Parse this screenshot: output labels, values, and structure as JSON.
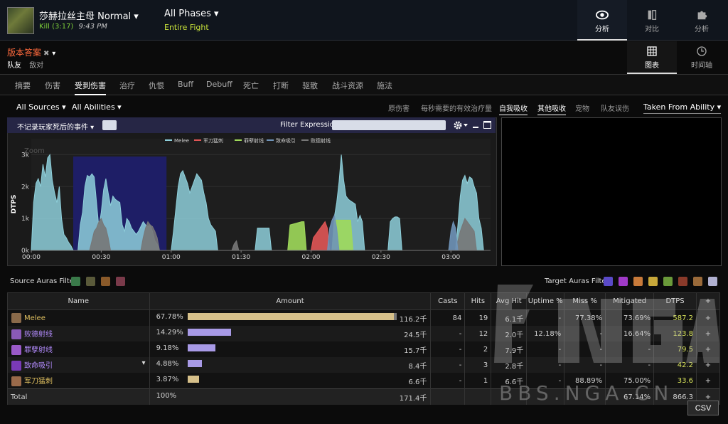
{
  "header": {
    "boss_name": "莎赫拉丝主母 Normal ▾",
    "kill": "Kill (3:17)",
    "time": "9:43 PM",
    "phases": "All Phases ▾",
    "fight": "Entire Fight",
    "nav": [
      {
        "label": "分析",
        "icon": "eye-icon"
      },
      {
        "label": "对比",
        "icon": "compare-icon"
      },
      {
        "label": "分析",
        "icon": "puzzle-icon"
      }
    ]
  },
  "report": {
    "title": "版本答案",
    "close": "✖",
    "caret": "▾",
    "team_tabs": [
      "队友",
      "敌对"
    ]
  },
  "view_nav": [
    {
      "label": "图表",
      "icon": "grid-icon"
    },
    {
      "label": "时间轴",
      "icon": "clock-icon"
    }
  ],
  "tabs": [
    "摘要",
    "伤害",
    "受到伤害",
    "治疗",
    "仇恨",
    "Buff",
    "Debuff",
    "死亡",
    "打断",
    "驱散",
    "战斗资源",
    "施法"
  ],
  "filters": {
    "sources": "All Sources ▾",
    "abilities": "All Abilities ▾",
    "options": [
      "原伤害",
      "每秒需要的有效治疗量",
      "自我吸收",
      "其他吸收",
      "宠物",
      "队友误伤"
    ],
    "taken_from": "Taken From Ability ▾"
  },
  "graph": {
    "no_death": "不记录玩家死后的事件 ▾",
    "filter_label": "Filter Expression:",
    "filter_value": "",
    "settings_icon": "gear-icon"
  },
  "chart_data": {
    "type": "area",
    "title": "",
    "xlabel": "",
    "ylabel": "DTPS",
    "zoom_label": "Zoom",
    "xticks": [
      "00:00",
      "00:30",
      "01:00",
      "01:30",
      "02:00",
      "02:30",
      "03:00"
    ],
    "yticks": [
      "0k",
      "1k",
      "2k",
      "3k"
    ],
    "ylim": [
      0,
      3500
    ],
    "xlim": [
      0,
      197
    ],
    "grid": true,
    "legend_position": "top",
    "selection_range": [
      18,
      58
    ],
    "series": [
      {
        "name": "Melee",
        "color": "#8ecfda",
        "points": [
          [
            0,
            0
          ],
          [
            1,
            1500
          ],
          [
            2,
            2100
          ],
          [
            3,
            2250
          ],
          [
            4,
            2000
          ],
          [
            5,
            2700
          ],
          [
            6,
            2300
          ],
          [
            7,
            2900
          ],
          [
            8,
            3000
          ],
          [
            9,
            2200
          ],
          [
            10,
            1800
          ],
          [
            11,
            1500
          ],
          [
            12,
            2000
          ],
          [
            13,
            1000
          ],
          [
            14,
            500
          ],
          [
            15,
            400
          ],
          [
            16,
            250
          ],
          [
            17,
            150
          ],
          [
            18,
            0
          ],
          [
            20,
            0
          ],
          [
            21,
            800
          ],
          [
            22,
            1200
          ],
          [
            23,
            2000
          ],
          [
            24,
            2350
          ],
          [
            25,
            2300
          ],
          [
            26,
            2400
          ],
          [
            27,
            2300
          ],
          [
            28,
            1500
          ],
          [
            29,
            700
          ],
          [
            30,
            1200
          ],
          [
            31,
            1900
          ],
          [
            32,
            2250
          ],
          [
            33,
            1800
          ],
          [
            34,
            1400
          ],
          [
            35,
            1700
          ],
          [
            36,
            1600
          ],
          [
            37,
            1550
          ],
          [
            38,
            1500
          ],
          [
            39,
            800
          ],
          [
            40,
            600
          ],
          [
            41,
            1000
          ],
          [
            42,
            900
          ],
          [
            43,
            700
          ],
          [
            44,
            600
          ],
          [
            45,
            500
          ],
          [
            46,
            600
          ],
          [
            47,
            750
          ],
          [
            48,
            900
          ],
          [
            49,
            800
          ],
          [
            50,
            750
          ],
          [
            51,
            800
          ],
          [
            52,
            600
          ],
          [
            53,
            300
          ],
          [
            54,
            200
          ],
          [
            55,
            0
          ],
          [
            60,
            0
          ],
          [
            61,
            600
          ],
          [
            62,
            1300
          ],
          [
            63,
            2000
          ],
          [
            64,
            2400
          ],
          [
            65,
            2500
          ],
          [
            66,
            2300
          ],
          [
            67,
            2100
          ],
          [
            68,
            1800
          ],
          [
            69,
            2000
          ],
          [
            70,
            2200
          ],
          [
            71,
            2400
          ],
          [
            72,
            2300
          ],
          [
            73,
            2200
          ],
          [
            74,
            1800
          ],
          [
            75,
            1500
          ],
          [
            76,
            1000
          ],
          [
            77,
            800
          ],
          [
            78,
            700
          ],
          [
            79,
            600
          ],
          [
            80,
            0
          ],
          [
            96,
            0
          ],
          [
            97,
            700
          ],
          [
            98,
            700
          ],
          [
            99,
            700
          ],
          [
            100,
            700
          ],
          [
            101,
            700
          ],
          [
            102,
            700
          ],
          [
            103,
            0
          ],
          [
            129,
            0
          ],
          [
            130,
            1050
          ],
          [
            131,
            1500
          ],
          [
            132,
            2150
          ],
          [
            133,
            3000
          ],
          [
            134,
            2200
          ],
          [
            135,
            1700
          ],
          [
            136,
            1600
          ],
          [
            137,
            1550
          ],
          [
            138,
            1500
          ],
          [
            139,
            1450
          ],
          [
            140,
            900
          ],
          [
            141,
            1100
          ],
          [
            142,
            900
          ],
          [
            143,
            0
          ],
          [
            153,
            0
          ],
          [
            154,
            900
          ],
          [
            155,
            1000
          ],
          [
            156,
            1050
          ],
          [
            157,
            1050
          ],
          [
            158,
            1000
          ],
          [
            159,
            0
          ],
          [
            182,
            0
          ],
          [
            183,
            800
          ],
          [
            184,
            1700
          ],
          [
            185,
            2200
          ],
          [
            186,
            2350
          ],
          [
            187,
            2100
          ],
          [
            188,
            2300
          ],
          [
            189,
            2250
          ],
          [
            190,
            2000
          ],
          [
            191,
            1800
          ],
          [
            192,
            1000
          ],
          [
            193,
            700
          ],
          [
            194,
            0
          ]
        ]
      },
      {
        "name": "军刀猛刺",
        "color": "#e05555",
        "points": [
          [
            120,
            0
          ],
          [
            121,
            400
          ],
          [
            126,
            900
          ],
          [
            127,
            700
          ],
          [
            128,
            0
          ]
        ]
      },
      {
        "name": "罪孽射线",
        "color": "#9fd95a",
        "points": [
          [
            110,
            0
          ],
          [
            111,
            800
          ],
          [
            116,
            900
          ],
          [
            117,
            900
          ],
          [
            118,
            0
          ],
          [
            129,
            0
          ],
          [
            130,
            950
          ],
          [
            132,
            950
          ],
          [
            136,
            950
          ],
          [
            137,
            950
          ],
          [
            138,
            0
          ]
        ]
      },
      {
        "name": "致命吸引",
        "color": "#6f93b8",
        "points": [
          [
            127,
            0
          ],
          [
            128,
            700
          ],
          [
            129,
            950
          ],
          [
            130,
            1100
          ],
          [
            131,
            700
          ],
          [
            132,
            0
          ],
          [
            179,
            0
          ],
          [
            180,
            600
          ],
          [
            181,
            900
          ],
          [
            182,
            700
          ],
          [
            183,
            0
          ]
        ]
      },
      {
        "name": "败德射线",
        "color": "#777777",
        "points": [
          [
            25,
            0
          ],
          [
            26,
            300
          ],
          [
            27,
            600
          ],
          [
            28,
            700
          ],
          [
            29,
            900
          ],
          [
            30,
            1000
          ],
          [
            31,
            800
          ],
          [
            32,
            700
          ],
          [
            33,
            400
          ],
          [
            34,
            0
          ],
          [
            47,
            0
          ],
          [
            48,
            400
          ],
          [
            49,
            700
          ],
          [
            50,
            900
          ],
          [
            51,
            800
          ],
          [
            52,
            750
          ],
          [
            53,
            600
          ],
          [
            54,
            400
          ],
          [
            55,
            0
          ],
          [
            86,
            0
          ],
          [
            87,
            200
          ],
          [
            88,
            300
          ],
          [
            89,
            0
          ],
          [
            182,
            0
          ],
          [
            183,
            300
          ],
          [
            184,
            600
          ],
          [
            185,
            800
          ],
          [
            186,
            1000
          ],
          [
            187,
            900
          ],
          [
            188,
            800
          ],
          [
            189,
            700
          ],
          [
            190,
            600
          ],
          [
            191,
            0
          ]
        ]
      }
    ]
  },
  "auras": {
    "source_label": "Source Auras Filter:",
    "source_icons": [
      {
        "name": "aura-icon-1",
        "color": "#3a7a4a"
      },
      {
        "name": "aura-icon-2",
        "color": "#5a5a3a"
      },
      {
        "name": "aura-icon-3",
        "color": "#8a5a2a"
      },
      {
        "name": "aura-icon-4",
        "color": "#7a3a4a"
      }
    ],
    "target_label": "Target Auras Filter:",
    "target_icons": [
      {
        "name": "aura-icon-a",
        "color": "#5a4ac8"
      },
      {
        "name": "aura-icon-b",
        "color": "#a03ac8"
      },
      {
        "name": "aura-icon-c",
        "color": "#c87a3a"
      },
      {
        "name": "aura-icon-d",
        "color": "#c8a83a"
      },
      {
        "name": "aura-icon-e",
        "color": "#6a9a3a"
      },
      {
        "name": "aura-icon-f",
        "color": "#8a3a2a"
      },
      {
        "name": "aura-icon-g",
        "color": "#9a6a3a"
      },
      {
        "name": "aura-icon-h",
        "color": "#b0b0d0"
      }
    ]
  },
  "table": {
    "headers": [
      "Name",
      "Amount",
      "Casts",
      "Hits",
      "Avg Hit",
      "Uptime %",
      "Miss %",
      "Mitigated",
      "DTPS",
      "+"
    ],
    "rows": [
      {
        "name": "Melee",
        "pct": "67.78%",
        "fraction": 0.6778,
        "bar_color": "#d6c08a",
        "amount": "116.2千",
        "casts": "84",
        "hits": "19",
        "avg": "6.1千",
        "uptime": "-",
        "miss": "77.38%",
        "mitigated": "73.69%",
        "dtps": "587.2",
        "plus": "+",
        "icon_color": "#8a6a4a",
        "style": "melee"
      },
      {
        "name": "败德射线",
        "pct": "14.29%",
        "fraction": 0.1429,
        "bar_color": "#a89ae6",
        "amount": "24.5千",
        "casts": "-",
        "hits": "12",
        "avg": "2.0千",
        "uptime": "12.18%",
        "miss": "-",
        "mitigated": "16.64%",
        "dtps": "123.8",
        "plus": "+",
        "icon_color": "#8a5ab8",
        "style": "mag"
      },
      {
        "name": "罪孽射线",
        "pct": "9.18%",
        "fraction": 0.0918,
        "bar_color": "#a89ae6",
        "amount": "15.7千",
        "casts": "-",
        "hits": "2",
        "avg": "7.9千",
        "uptime": "-",
        "miss": "-",
        "mitigated": "-",
        "dtps": "79.5",
        "plus": "+",
        "icon_color": "#9a5ac8",
        "style": "mag"
      },
      {
        "name": "致命吸引",
        "pct": "4.88%",
        "fraction": 0.0488,
        "bar_color": "#a89ae6",
        "amount": "8.4千",
        "casts": "-",
        "hits": "3",
        "avg": "2.8千",
        "uptime": "-",
        "miss": "-",
        "mitigated": "-",
        "dtps": "42.2",
        "plus": "+",
        "icon_color": "#7a3ab8",
        "style": "mag",
        "caret": "▾"
      },
      {
        "name": "军刀猛刺",
        "pct": "3.87%",
        "fraction": 0.0387,
        "bar_color": "#d6c08a",
        "amount": "6.6千",
        "casts": "-",
        "hits": "1",
        "avg": "6.6千",
        "uptime": "-",
        "miss": "88.89%",
        "mitigated": "75.00%",
        "dtps": "33.6",
        "plus": "+",
        "icon_color": "#9a6a4a",
        "style": "melee"
      }
    ],
    "total": {
      "name": "Total",
      "pct": "100%",
      "amount": "171.4千",
      "mitigated": "67.14%",
      "dtps": "866.3",
      "plus": "+"
    }
  },
  "csv_label": "CSV",
  "watermark": {
    "text": "BBS.NGA.CN",
    "logo": "NGA"
  }
}
